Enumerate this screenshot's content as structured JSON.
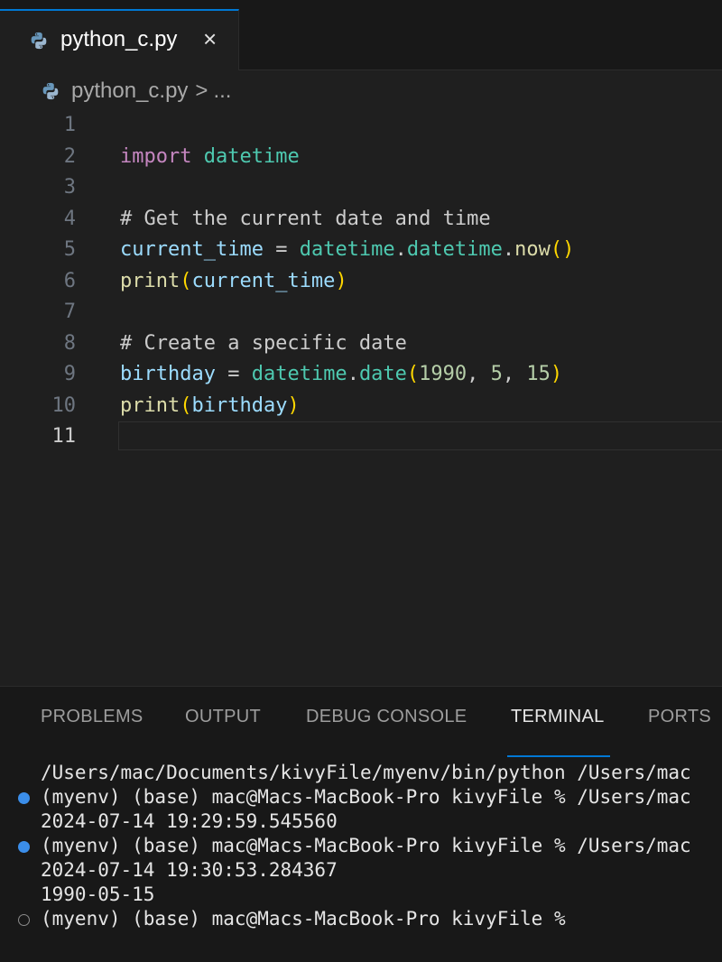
{
  "tab": {
    "title": "python_c.py",
    "close_symbol": "×",
    "icon": "python-icon"
  },
  "breadcrumb": {
    "file": "python_c.py",
    "separator": ">",
    "more": "..."
  },
  "editor": {
    "active_line": "11",
    "lines": [
      {
        "number": "1",
        "text": ""
      },
      {
        "number": "2",
        "text": "import datetime"
      },
      {
        "number": "3",
        "text": ""
      },
      {
        "number": "4",
        "text": "# Get the current date and time"
      },
      {
        "number": "5",
        "text": "current_time = datetime.datetime.now()"
      },
      {
        "number": "6",
        "text": "print(current_time)"
      },
      {
        "number": "7",
        "text": ""
      },
      {
        "number": "8",
        "text": "# Create a specific date"
      },
      {
        "number": "9",
        "text": "birthday = datetime.date(1990, 5, 15)"
      },
      {
        "number": "10",
        "text": "print(birthday)"
      },
      {
        "number": "11",
        "text": ""
      }
    ],
    "tokens": {
      "l2": [
        "import",
        " ",
        "datetime"
      ],
      "l4": [
        "# Get the current date and time"
      ],
      "l5": [
        "current_time",
        " = ",
        "datetime",
        ".",
        "datetime",
        ".",
        "now",
        "(",
        ")"
      ],
      "l6": [
        "print",
        "(",
        "current_time",
        ")"
      ],
      "l8": [
        "# Create a specific date"
      ],
      "l9": [
        "birthday",
        " = ",
        "datetime",
        ".",
        "date",
        "(",
        "1990",
        ", ",
        "5",
        ", ",
        "15",
        ")"
      ],
      "l10": [
        "print",
        "(",
        "birthday",
        ")"
      ]
    }
  },
  "panel": {
    "tabs": [
      "PROBLEMS",
      "OUTPUT",
      "DEBUG CONSOLE",
      "TERMINAL",
      "PORTS"
    ],
    "active_tab": "TERMINAL"
  },
  "terminal": {
    "lines": [
      {
        "marker": "none",
        "text": "/Users/mac/Documents/kivyFile/myenv/bin/python /Users/mac"
      },
      {
        "marker": "blue",
        "text": "(myenv) (base) mac@Macs-MacBook-Pro kivyFile % /Users/mac"
      },
      {
        "marker": "none",
        "text": "2024-07-14 19:29:59.545560"
      },
      {
        "marker": "blue",
        "text": "(myenv) (base) mac@Macs-MacBook-Pro kivyFile % /Users/mac"
      },
      {
        "marker": "none",
        "text": "2024-07-14 19:30:53.284367"
      },
      {
        "marker": "none",
        "text": "1990-05-15"
      },
      {
        "marker": "hollow",
        "text": "(myenv) (base) mac@Macs-MacBook-Pro kivyFile %"
      }
    ]
  },
  "colors": {
    "accent": "#0078d4",
    "keyword": "#c586c0",
    "module": "#4ec9b0",
    "variable": "#9cdcfe",
    "function": "#dcdcaa",
    "comment": "#6a9955",
    "number": "#b5cea8",
    "bracket": "#ffd700"
  }
}
